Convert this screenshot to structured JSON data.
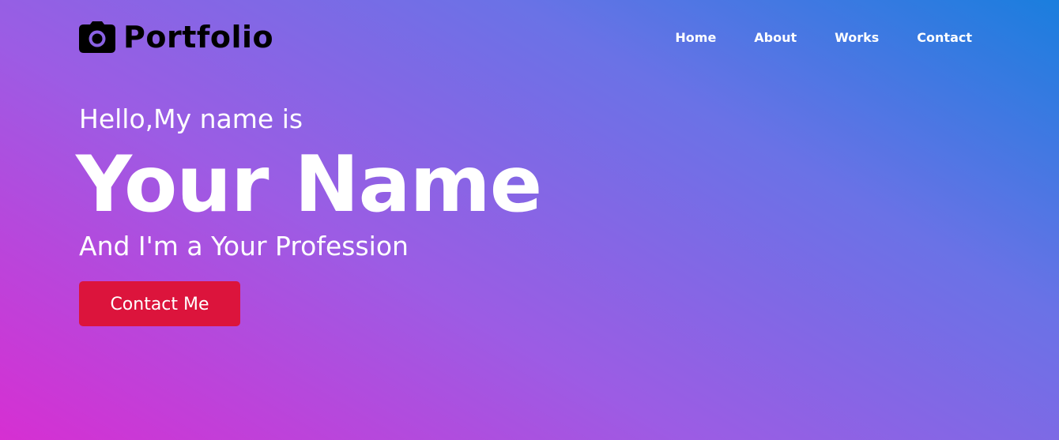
{
  "brand": {
    "icon": "camera-icon",
    "name": "Portfolio"
  },
  "nav": {
    "items": [
      {
        "label": "Home"
      },
      {
        "label": "About"
      },
      {
        "label": "Works"
      },
      {
        "label": "Contact"
      }
    ]
  },
  "hero": {
    "greeting": "Hello,My name is",
    "name": "Your Name",
    "profession": "And I'm a Your Profession",
    "cta_label": "Contact Me"
  },
  "colors": {
    "gradient_start": "#d62fd2",
    "gradient_mid": "#9c5ce4",
    "gradient_end": "#1a7ede",
    "cta": "#dc143c",
    "text": "#ffffff",
    "logo": "#000000"
  }
}
